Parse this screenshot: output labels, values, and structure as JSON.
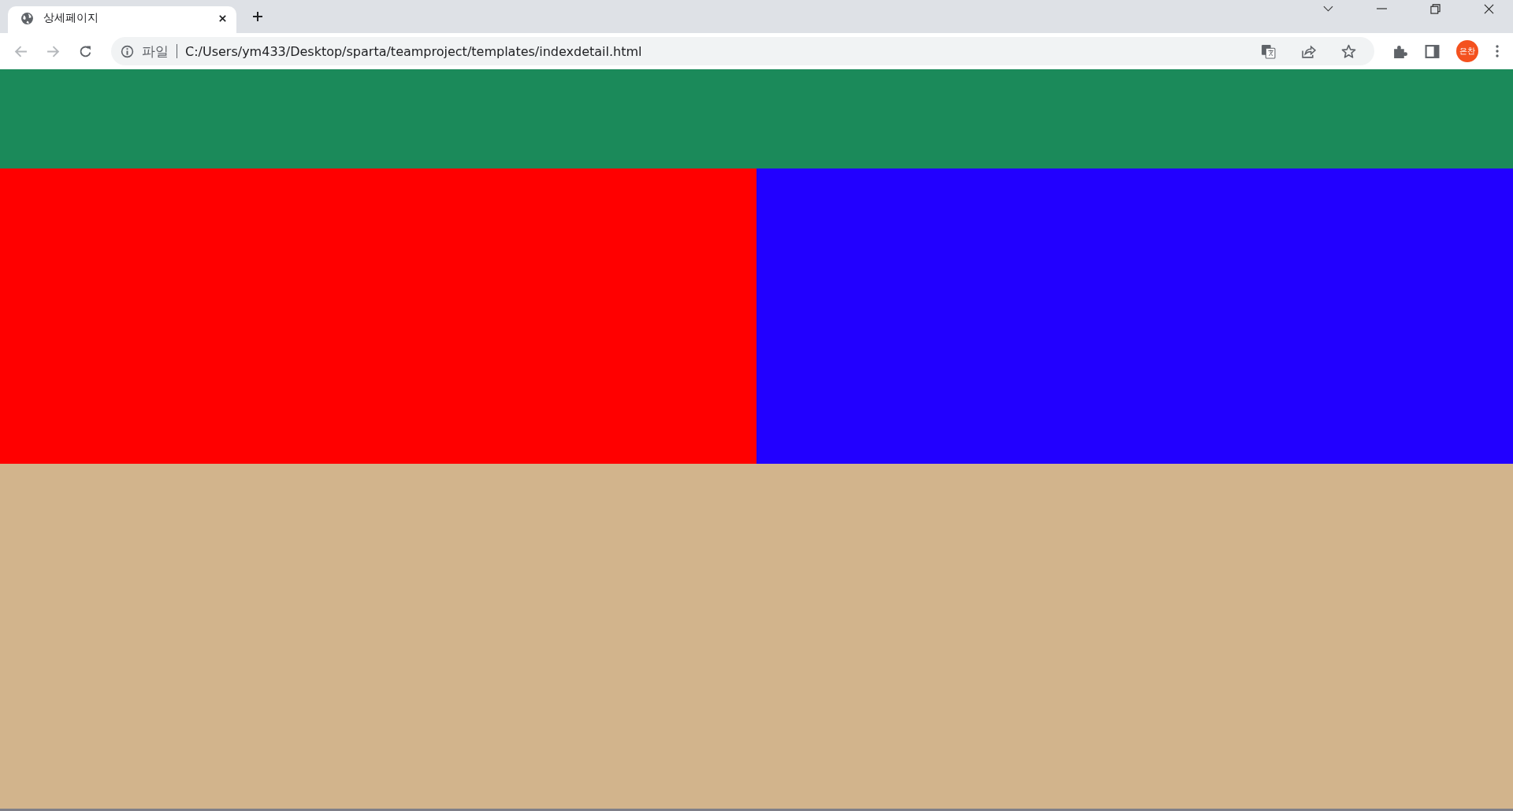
{
  "tabs": [
    {
      "title": "상세페이지",
      "selected": true
    }
  ],
  "address_bar": {
    "scheme_label": "파일",
    "url": "C:/Users/ym433/Desktop/sparta/teamproject/templates/indexdetail.html"
  },
  "profile": {
    "initials": "은찬"
  }
}
